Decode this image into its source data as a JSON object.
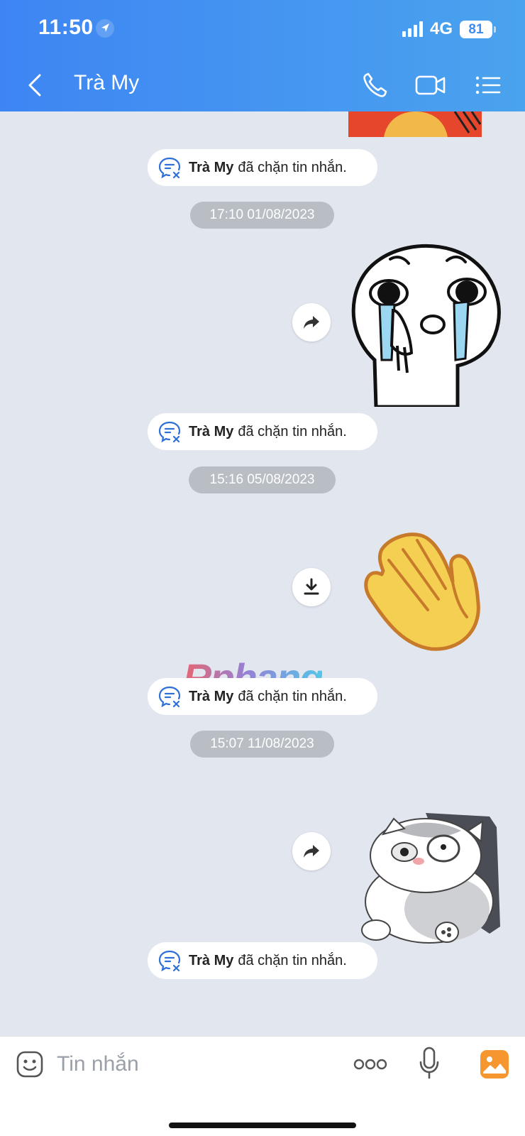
{
  "status_bar": {
    "time": "11:50",
    "network": "4G",
    "battery": "81"
  },
  "header": {
    "title": "Trà My",
    "icons": {
      "back": "chevron-left-icon",
      "call": "phone-icon",
      "video": "video-camera-icon",
      "menu": "list-menu-icon"
    }
  },
  "messages": {
    "notice_name": "Trà My",
    "notice_text": "đã chặn tin nhắn.",
    "timestamps": [
      "17:10 01/08/2023",
      "15:16 05/08/2023",
      "15:07 11/08/2023"
    ]
  },
  "watermark": "Rphang",
  "composer": {
    "placeholder": "Tin nhắn"
  },
  "colors": {
    "header_start": "#3e85f3",
    "header_end": "#4aa3ee",
    "chat_bg": "#e2e6ef",
    "notice_icon": "#2f6fd8"
  }
}
